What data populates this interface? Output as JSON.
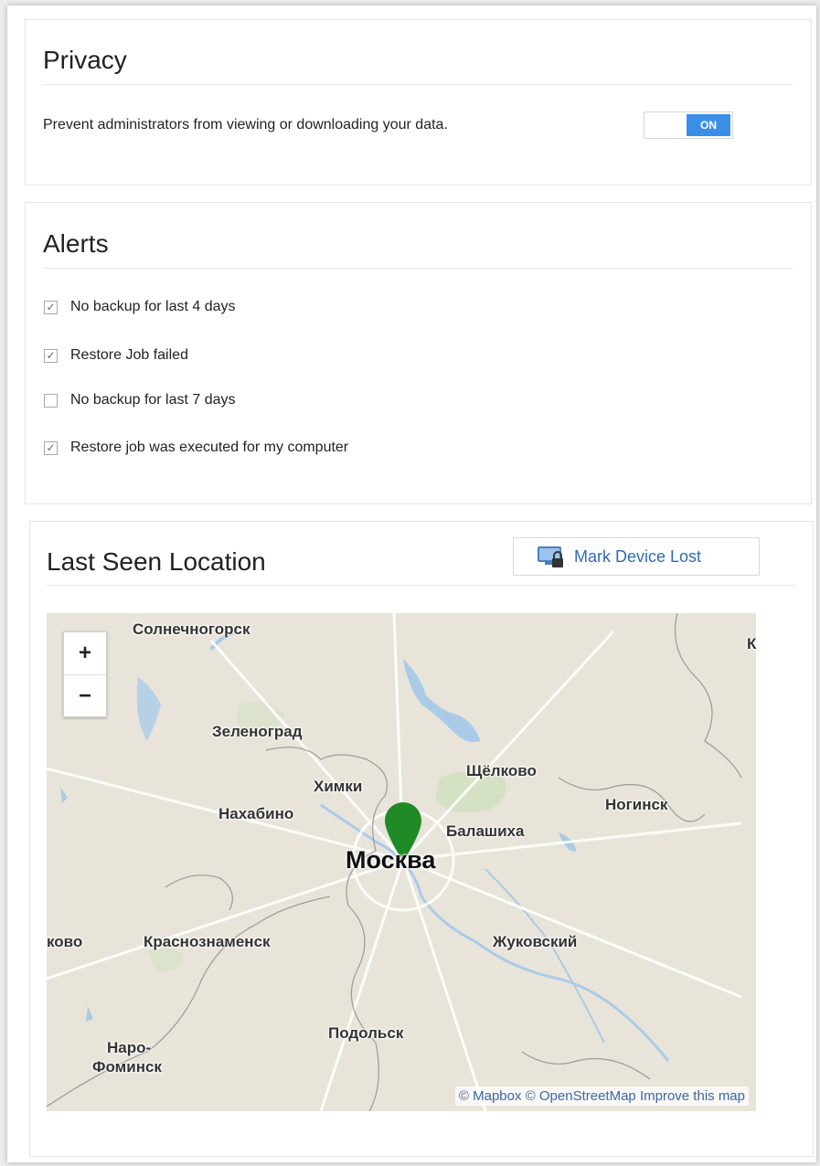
{
  "privacy": {
    "title": "Privacy",
    "description": "Prevent administrators from viewing or downloading your data.",
    "toggle_label": "ON"
  },
  "alerts": {
    "title": "Alerts",
    "items": [
      {
        "label": "No backup for last 4 days",
        "checked": true
      },
      {
        "label": "Restore Job failed",
        "checked": true
      },
      {
        "label": "No backup for last 7 days",
        "checked": false
      },
      {
        "label": "Restore job was executed for my computer",
        "checked": true
      }
    ]
  },
  "location": {
    "title": "Last Seen Location",
    "mark_lost_label": "Mark Device Lost",
    "map": {
      "zoom_in": "+",
      "zoom_out": "−",
      "cities": {
        "solnechnogorsk": "Солнечногорск",
        "zelenograd": "Зеленоград",
        "khimki": "Химки",
        "shchelkovo": "Щёлково",
        "noginsk": "Ногинск",
        "nakhabino": "Нахабино",
        "balashikha": "Балашиха",
        "moskva": "Москва",
        "kovo": "ково",
        "krasnoznamensk": "Краснознаменск",
        "zhukovsky": "Жуковский",
        "podolsk": "Подольск",
        "naro": "Наро-",
        "fominsk": "Фоминск",
        "k": "К"
      },
      "attribution": {
        "mapbox": "© Mapbox",
        "osm": "© OpenStreetMap",
        "improve": "Improve this map"
      }
    }
  }
}
